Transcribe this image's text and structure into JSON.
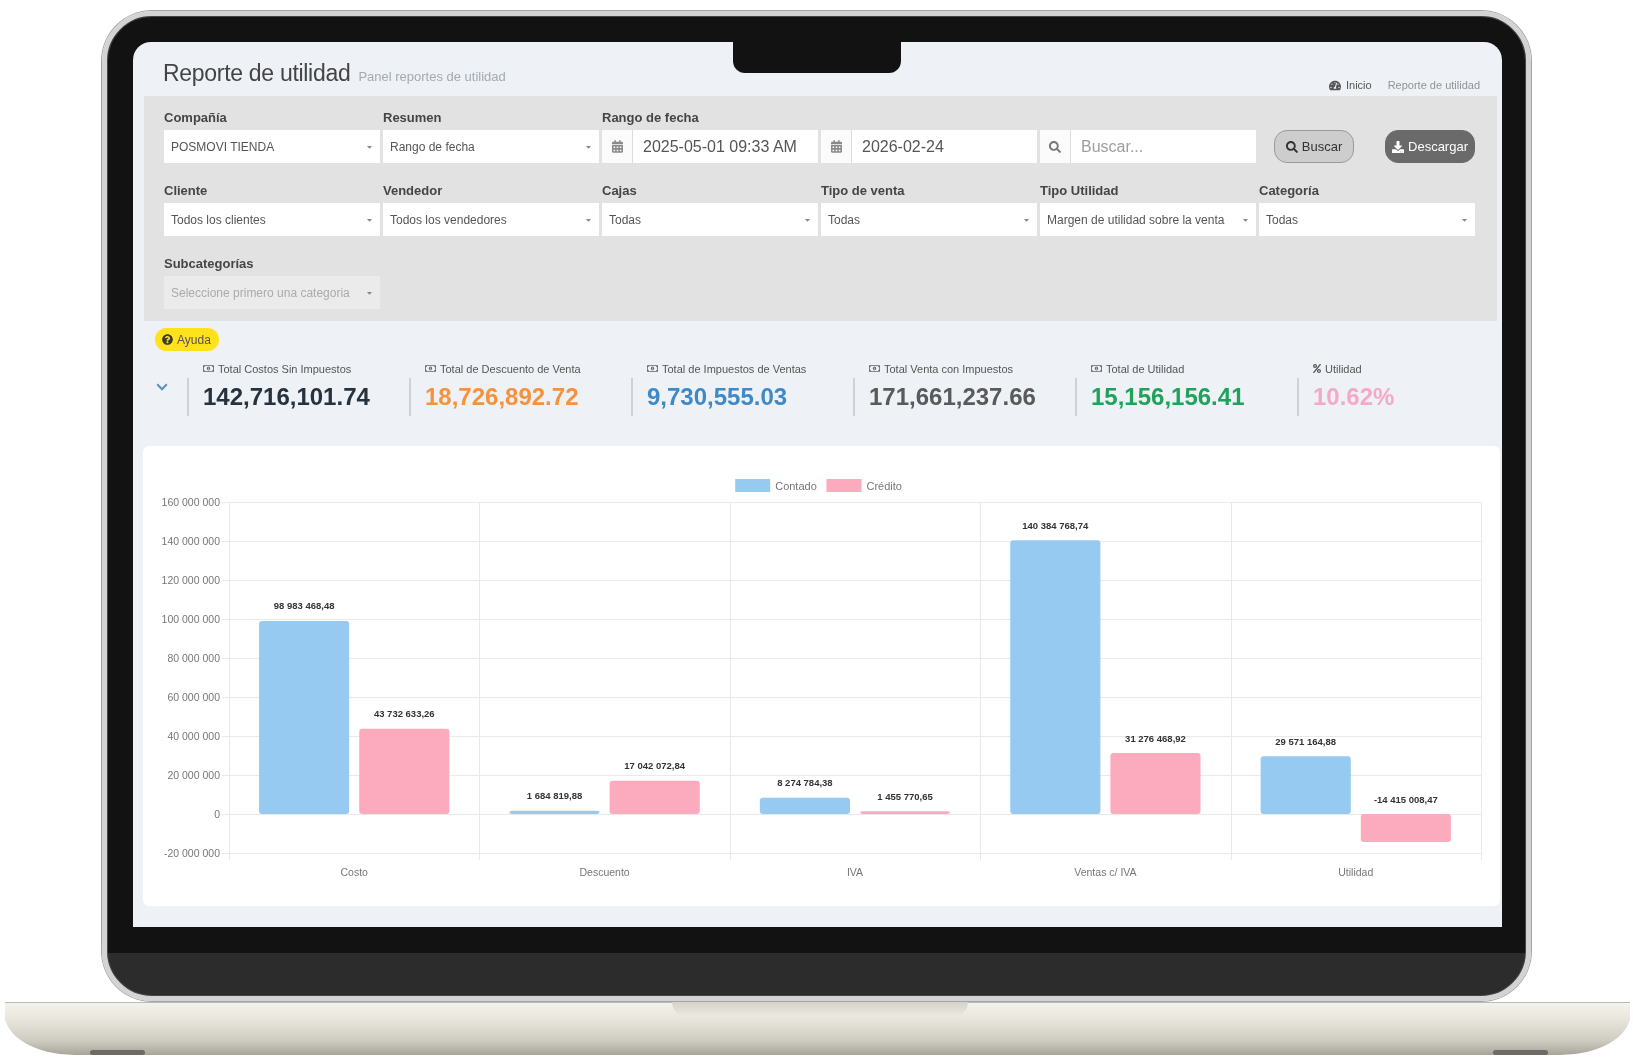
{
  "header": {
    "title": "Reporte de utilidad",
    "subtitle": "Panel reportes de utilidad",
    "breadcrumb": [
      {
        "label": "Inicio",
        "active": false
      },
      {
        "label": "Reporte de utilidad",
        "active": true
      }
    ]
  },
  "filters": {
    "fields": [
      {
        "kind": "select",
        "label": "Compañía",
        "value": "POSMOVI TIENDA",
        "disabled": false
      },
      {
        "kind": "select",
        "label": "Resumen",
        "value": "Rango de fecha",
        "disabled": false
      },
      {
        "kind": "date_range",
        "label": "Rango de fecha",
        "start": "2025-05-01 09:33 AM",
        "end": "2026-02-24"
      },
      {
        "kind": "search",
        "placeholder": "Buscar..."
      },
      {
        "kind": "actions",
        "buttons": [
          {
            "kind": "search",
            "label": "Buscar"
          },
          {
            "kind": "download",
            "label": "Descargar"
          }
        ]
      },
      {
        "kind": "select",
        "label": "Cliente",
        "value": "Todos los clientes",
        "disabled": false
      },
      {
        "kind": "select",
        "label": "Vendedor",
        "value": "Todos los vendedores",
        "disabled": false
      },
      {
        "kind": "select",
        "label": "Cajas",
        "value": "Todas",
        "disabled": false
      },
      {
        "kind": "select",
        "label": "Tipo de venta",
        "value": "Todas",
        "disabled": false
      },
      {
        "kind": "select",
        "label": "Tipo Utilidad",
        "value": "Margen de utilidad sobre la venta",
        "disabled": false
      },
      {
        "kind": "select",
        "label": "Categoría",
        "value": "Todas",
        "disabled": false
      },
      {
        "kind": "select",
        "label": "Subcategorías",
        "placeholder": "Seleccione primero una categoria",
        "disabled": true
      }
    ]
  },
  "summary": {
    "help_badge": "Ayuda",
    "kpis": [
      {
        "kind": "amount",
        "label": "Total Costos Sin Impuestos",
        "value": "142,716,101.74",
        "color": "#27323f"
      },
      {
        "kind": "amount",
        "label": "Total de Descuento de Venta",
        "value": "18,726,892.72",
        "color": "#f5923e"
      },
      {
        "kind": "amount",
        "label": "Total de Impuestos de Ventas",
        "value": "9,730,555.03",
        "color": "#3d8ac7"
      },
      {
        "kind": "amount",
        "label": "Total Venta con Impuestos",
        "value": "171,661,237.66",
        "color": "#5a5a5a"
      },
      {
        "kind": "amount",
        "label": "Total de Utilidad",
        "value": "15,156,156.41",
        "color": "#1fa35b"
      },
      {
        "kind": "percent",
        "label": "Utilidad",
        "value": "10.62%",
        "color": "#f6a8cb"
      }
    ]
  },
  "chart": {
    "chart_data": {
      "type": "bar",
      "categories": [
        "Costo",
        "Descuento",
        "IVA",
        "Ventas c/ IVA",
        "Utilidad"
      ],
      "series": [
        {
          "name": "Contado",
          "color": "#97caf1",
          "values": [
            98983468.48,
            1684819.88,
            8274784.38,
            140384768.74,
            29571164.88
          ]
        },
        {
          "name": "Crédito",
          "color": "#fbabbd",
          "values": [
            43732633.26,
            17042072.84,
            1455770.65,
            31276468.92,
            -14415008.47
          ]
        }
      ],
      "ylim": [
        -20000000,
        160000000
      ],
      "yticks": [
        {
          "value": -20000000,
          "label": "-20 000 000"
        },
        {
          "value": 0,
          "label": "0"
        },
        {
          "value": 20000000,
          "label": "20 000 000"
        },
        {
          "value": 40000000,
          "label": "40 000 000"
        },
        {
          "value": 60000000,
          "label": "60 000 000"
        },
        {
          "value": 80000000,
          "label": "80 000 000"
        },
        {
          "value": 100000000,
          "label": "100 000 000"
        },
        {
          "value": 120000000,
          "label": "120 000 000"
        },
        {
          "value": 140000000,
          "label": "140 000 000"
        },
        {
          "value": 160000000,
          "label": "160 000 000"
        }
      ],
      "grid": true,
      "legend": "top",
      "value_labels": [
        [
          "98 983 468,48",
          "1 684 819,88",
          "8 274 784,38",
          "140 384 768,74",
          "29 571 164,88"
        ],
        [
          "43 732 633,26",
          "17 042 072,84",
          "1 455 770,65",
          "31 276 468,92",
          "-14 415 008,47"
        ]
      ]
    }
  }
}
